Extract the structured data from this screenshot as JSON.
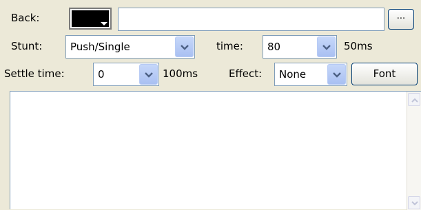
{
  "back": {
    "label": "Back:",
    "color": "#000000",
    "path_value": "",
    "browse_label": "..."
  },
  "stunt": {
    "label": "Stunt:",
    "selected": "Push/Single",
    "time_label": "time:",
    "time_selected": "80",
    "time_unit": "50ms"
  },
  "settle": {
    "label": "Settle time:",
    "selected": "0",
    "unit": "100ms"
  },
  "effect": {
    "label": "Effect:",
    "selected": "None"
  },
  "font": {
    "button_label": "Font"
  },
  "text": {
    "value": ""
  },
  "icons": {
    "dropdown": "chevron-down-icon",
    "scroll_up": "arrow-up-icon",
    "scroll_down": "arrow-down-icon"
  }
}
